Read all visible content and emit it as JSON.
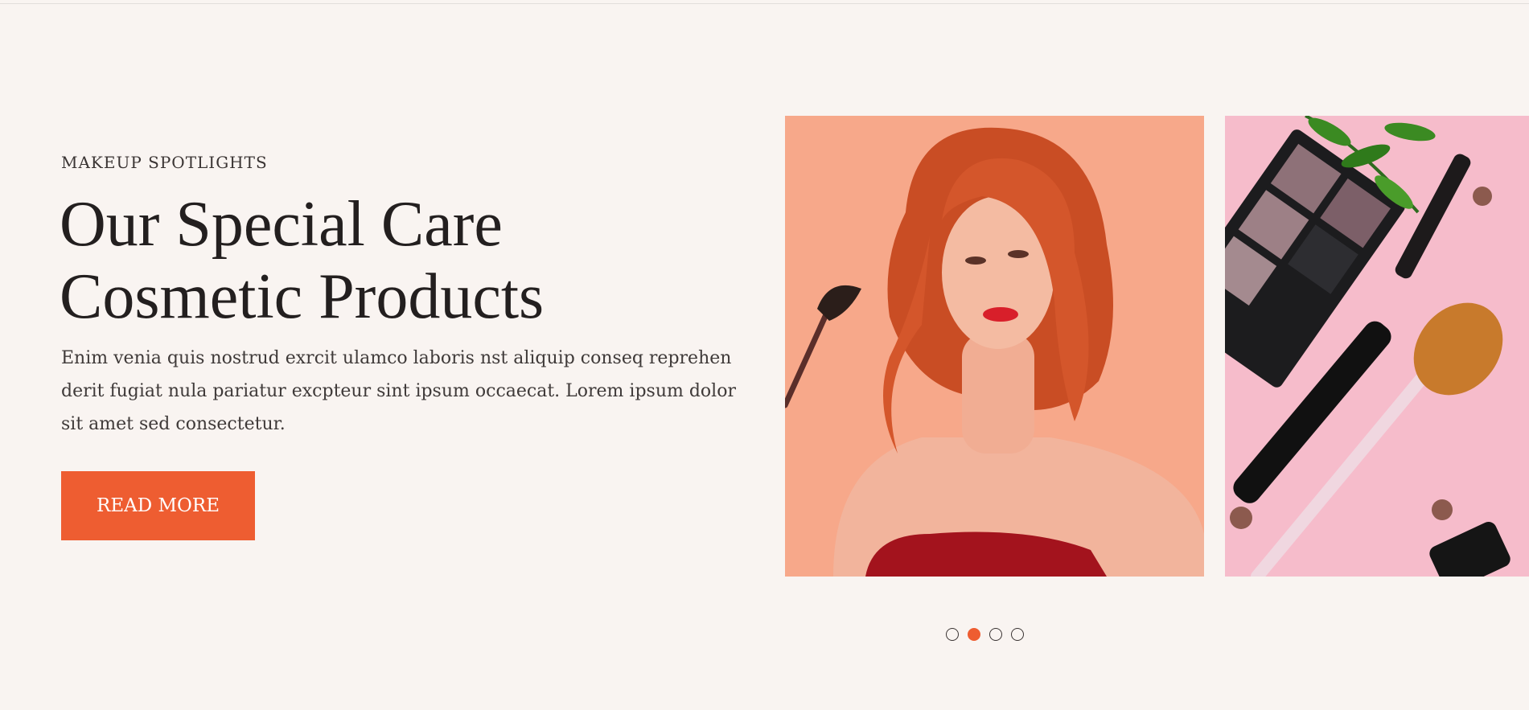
{
  "hero": {
    "eyebrow": "MAKEUP SPOTLIGHTS",
    "title_line1": "Our Special Care",
    "title_line2": "Cosmetic Products",
    "description": "Enim venia quis nostrud exrcit ulamco laboris nst aliquip conseq reprehen derit fugiat nula pariatur excpteur sint ipsum occaecat. Lorem ipsum dolor sit amet sed consectetur.",
    "button_label": "READ MORE"
  },
  "carousel": {
    "slides": [
      {
        "image": "red-haired-woman-with-makeup-brush"
      },
      {
        "image": "makeup-products-flatlay"
      }
    ],
    "dot_count": 4,
    "active_dot": 2
  },
  "colors": {
    "background": "#f9f4f1",
    "accent": "#ee5d31",
    "text": "#231f1f"
  }
}
